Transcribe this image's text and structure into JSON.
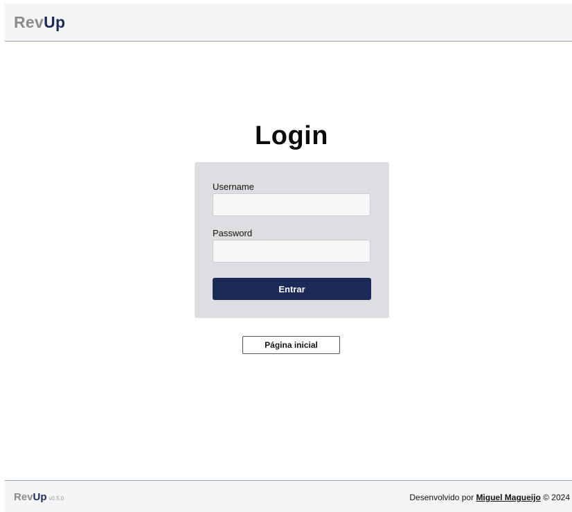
{
  "header": {
    "brand_rev": "Rev",
    "brand_up": "Up"
  },
  "page": {
    "title": "Login"
  },
  "form": {
    "username_label": "Username",
    "username_value": "",
    "password_label": "Password",
    "password_value": "",
    "submit_label": "Entrar"
  },
  "home_button_label": "Página inicial",
  "footer": {
    "brand_rev": "Rev",
    "brand_up": "Up",
    "version": "v0.5.0",
    "credits_prefix": "Desenvolvido por ",
    "author": "Miguel Magueijo",
    "credits_suffix": " © 2024"
  },
  "colors": {
    "brand_dark": "#1b2a56",
    "brand_gray": "#8a8a8a",
    "card_bg": "#dddee1",
    "bar_bg": "#f4f5f7"
  }
}
